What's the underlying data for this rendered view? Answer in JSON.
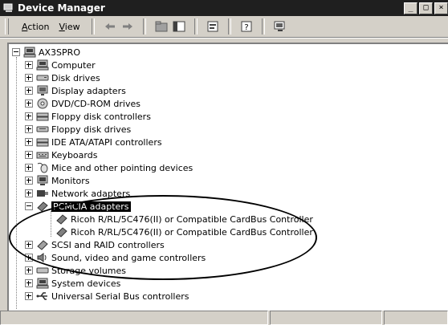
{
  "window": {
    "title": "Device Manager"
  },
  "winbuttons": [
    "_",
    "□",
    "×"
  ],
  "menu": [
    {
      "accel": "A",
      "rest": "ction"
    },
    {
      "accel": "V",
      "rest": "iew"
    }
  ],
  "tree": {
    "root": "AX3SPRO",
    "categories": [
      {
        "label": "Computer",
        "icon": "computer-icon"
      },
      {
        "label": "Disk drives",
        "icon": "disk-drive-icon"
      },
      {
        "label": "Display adapters",
        "icon": "display-adapter-icon"
      },
      {
        "label": "DVD/CD-ROM drives",
        "icon": "cd-rom-icon"
      },
      {
        "label": "Floppy disk controllers",
        "icon": "controller-icon"
      },
      {
        "label": "Floppy disk drives",
        "icon": "floppy-drive-icon"
      },
      {
        "label": "IDE ATA/ATAPI controllers",
        "icon": "controller-icon"
      },
      {
        "label": "Keyboards",
        "icon": "keyboard-icon"
      },
      {
        "label": "Mice and other pointing devices",
        "icon": "mouse-icon"
      },
      {
        "label": "Monitors",
        "icon": "monitor-icon"
      },
      {
        "label": "Network adapters",
        "icon": "network-adapter-icon"
      },
      {
        "label": "PCMCIA adapters",
        "icon": "pcmcia-icon",
        "expanded": true,
        "selected": true,
        "children": [
          "Ricoh R/RL/5C476(II) or Compatible CardBus Controller",
          "Ricoh R/RL/5C476(II) or Compatible CardBus Controller"
        ]
      },
      {
        "label": "SCSI and RAID controllers",
        "icon": "scsi-icon"
      },
      {
        "label": "Sound, video and game controllers",
        "icon": "sound-icon"
      },
      {
        "label": "Storage volumes",
        "icon": "storage-icon"
      },
      {
        "label": "System devices",
        "icon": "system-icon"
      },
      {
        "label": "Universal Serial Bus controllers",
        "icon": "usb-icon"
      }
    ]
  }
}
